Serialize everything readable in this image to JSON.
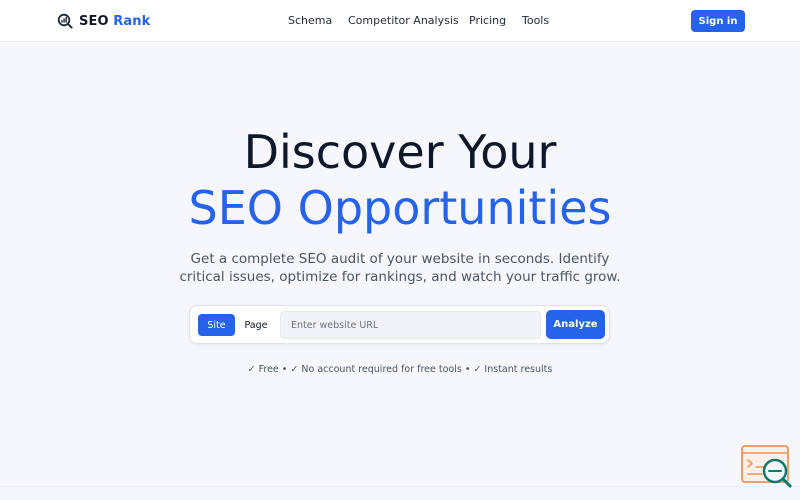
{
  "brand": {
    "name_part1": "SEO",
    "name_part2": "Rank",
    "accent_color": "#2563eb"
  },
  "nav": {
    "items": [
      {
        "label": "Schema"
      },
      {
        "label": "Competitor Analysis"
      },
      {
        "label": "Pricing"
      },
      {
        "label": "Tools"
      }
    ],
    "signin_label": "Sign in"
  },
  "hero": {
    "line1": "Discover Your",
    "line2": "SEO Opportunities",
    "subtitle": "Get a complete SEO audit of your website in seconds. Identify critical issues, optimize for rankings, and watch your traffic grow."
  },
  "search": {
    "modes": [
      {
        "label": "Site",
        "selected": true
      },
      {
        "label": "Page",
        "selected": false
      }
    ],
    "placeholder": "Enter website URL",
    "value": "",
    "submit_label": "Analyze"
  },
  "features": "✓ Free • ✓ No account required for free tools • ✓ Instant results",
  "icons": {
    "logo": "chart-magnifier-icon",
    "widget": "search-report-icon"
  }
}
